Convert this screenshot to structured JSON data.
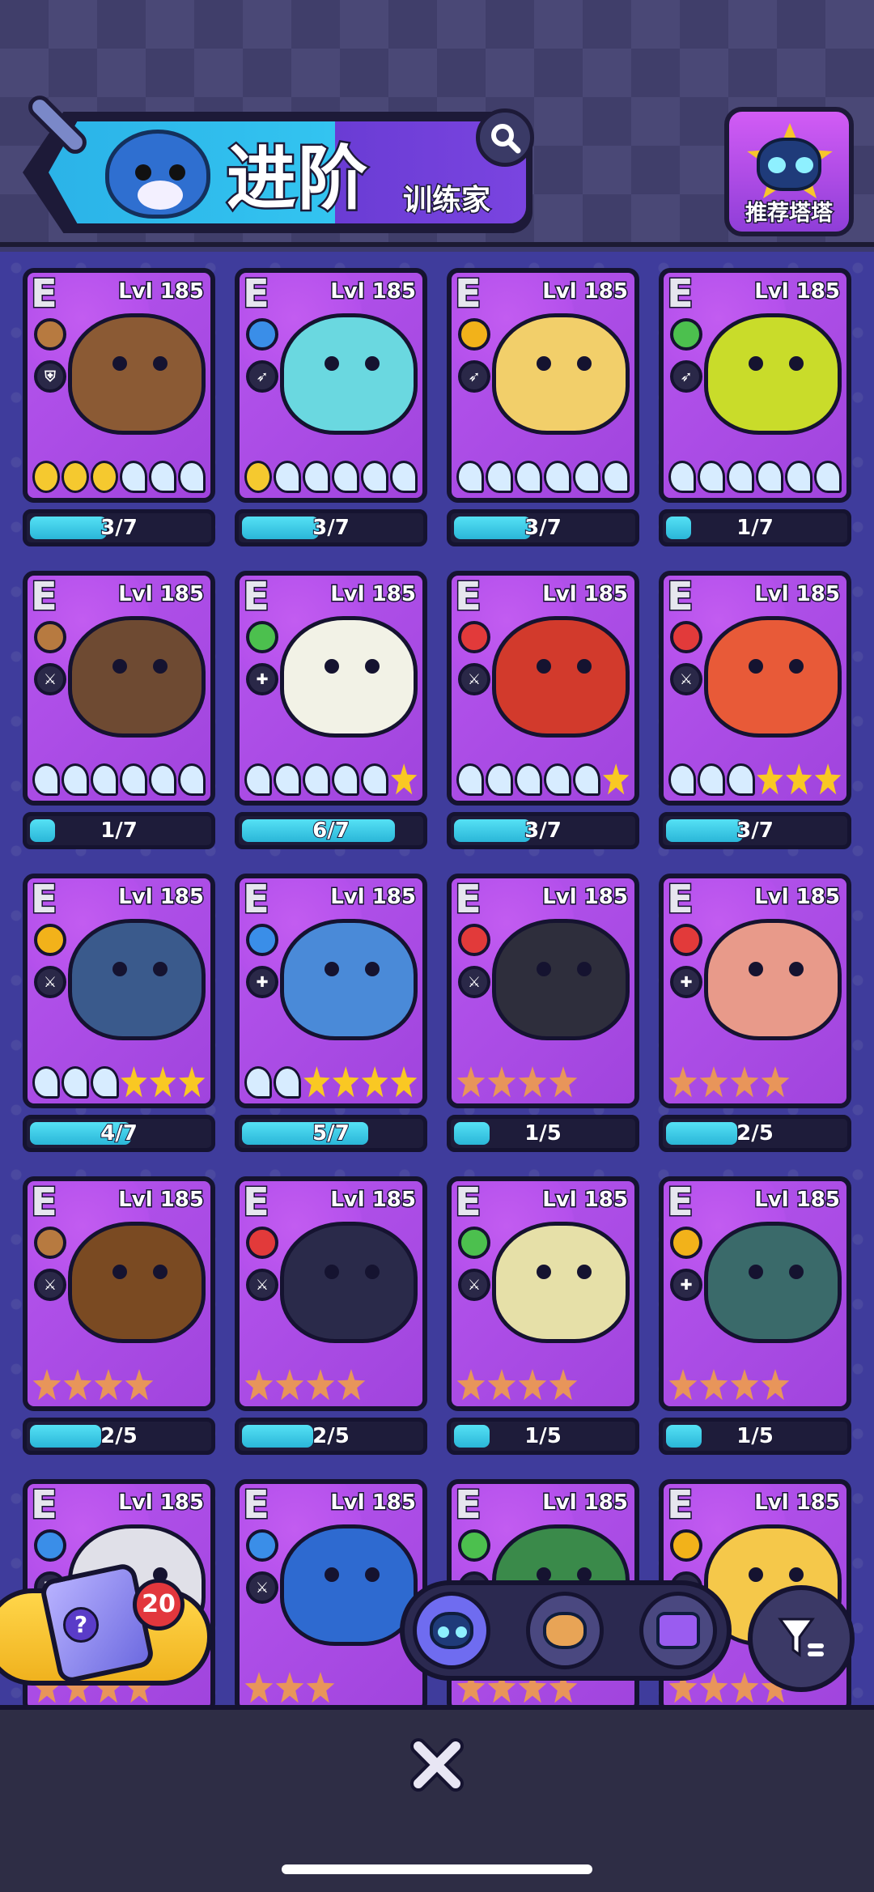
{
  "header": {
    "title": "进阶",
    "subtitle": "训练家",
    "recommend_label": "推荐塔塔"
  },
  "icons": {
    "search": "search-icon",
    "close": "close-icon",
    "sort": "filter-sort-icon",
    "chest": "mystery-box-icon"
  },
  "colors": {
    "card_bg": "#a346e0",
    "progress_fill": "#2ab6d8",
    "star_gold": "#f9c823",
    "star_bronze": "#e8955a",
    "accent_yellow": "#f0b21e",
    "badge_red": "#e2373d"
  },
  "cards": [
    {
      "grade": "E",
      "level": "Lvl 185",
      "type": "earth",
      "role": "shield",
      "ranks": [
        "moon",
        "moon",
        "moon",
        "wave",
        "wave",
        "wave"
      ],
      "progress_text": "3/7",
      "progress": 0.43,
      "creature_color": "#8b5a34"
    },
    {
      "grade": "E",
      "level": "Lvl 185",
      "type": "water",
      "role": "dash",
      "ranks": [
        "moon",
        "wave",
        "wave",
        "wave",
        "wave",
        "wave"
      ],
      "progress_text": "3/7",
      "progress": 0.43,
      "creature_color": "#6ad8e0"
    },
    {
      "grade": "E",
      "level": "Lvl 185",
      "type": "electric",
      "role": "dash",
      "ranks": [
        "wave",
        "wave",
        "wave",
        "wave",
        "wave",
        "wave"
      ],
      "progress_text": "3/7",
      "progress": 0.43,
      "creature_color": "#f2cf6a"
    },
    {
      "grade": "E",
      "level": "Lvl 185",
      "type": "grass",
      "role": "dash",
      "ranks": [
        "wave",
        "wave",
        "wave",
        "wave",
        "wave",
        "wave"
      ],
      "progress_text": "1/7",
      "progress": 0.14,
      "creature_color": "#c9dc2a"
    },
    {
      "grade": "E",
      "level": "Lvl 185",
      "type": "earth",
      "role": "sword",
      "ranks": [
        "wave",
        "wave",
        "wave",
        "wave",
        "wave",
        "wave"
      ],
      "progress_text": "1/7",
      "progress": 0.14,
      "creature_color": "#6e4a32"
    },
    {
      "grade": "E",
      "level": "Lvl 185",
      "type": "grass",
      "role": "heal",
      "ranks": [
        "wave",
        "wave",
        "wave",
        "wave",
        "wave",
        "star"
      ],
      "progress_text": "6/7",
      "progress": 0.86,
      "creature_color": "#f2f2e6"
    },
    {
      "grade": "E",
      "level": "Lvl 185",
      "type": "fire",
      "role": "sword",
      "ranks": [
        "wave",
        "wave",
        "wave",
        "wave",
        "wave",
        "star"
      ],
      "progress_text": "3/7",
      "progress": 0.43,
      "creature_color": "#d23a2c"
    },
    {
      "grade": "E",
      "level": "Lvl 185",
      "type": "fire",
      "role": "sword",
      "ranks": [
        "wave",
        "wave",
        "wave",
        "star",
        "star",
        "star"
      ],
      "progress_text": "3/7",
      "progress": 0.43,
      "creature_color": "#e85a38"
    },
    {
      "grade": "E",
      "level": "Lvl 185",
      "type": "electric",
      "role": "sword",
      "ranks": [
        "wave",
        "wave",
        "wave",
        "star",
        "star",
        "star"
      ],
      "progress_text": "4/7",
      "progress": 0.57,
      "creature_color": "#3a5a8c"
    },
    {
      "grade": "E",
      "level": "Lvl 185",
      "type": "water",
      "role": "heal",
      "ranks": [
        "wave",
        "wave",
        "star",
        "star",
        "star",
        "star"
      ],
      "progress_text": "5/7",
      "progress": 0.71,
      "creature_color": "#4a8ad8"
    },
    {
      "grade": "E",
      "level": "Lvl 185",
      "type": "fire",
      "role": "sword",
      "ranks": [
        "bstar",
        "bstar",
        "bstar",
        "bstar"
      ],
      "progress_text": "1/5",
      "progress": 0.2,
      "creature_color": "#2e2e3c"
    },
    {
      "grade": "E",
      "level": "Lvl 185",
      "type": "fire",
      "role": "heal",
      "ranks": [
        "bstar",
        "bstar",
        "bstar",
        "bstar"
      ],
      "progress_text": "2/5",
      "progress": 0.4,
      "creature_color": "#e89a8a"
    },
    {
      "grade": "E",
      "level": "Lvl 185",
      "type": "earth",
      "role": "sword",
      "ranks": [
        "bstar",
        "bstar",
        "bstar",
        "bstar"
      ],
      "progress_text": "2/5",
      "progress": 0.4,
      "creature_color": "#7a4a22"
    },
    {
      "grade": "E",
      "level": "Lvl 185",
      "type": "fire",
      "role": "sword",
      "ranks": [
        "bstar",
        "bstar",
        "bstar",
        "bstar"
      ],
      "progress_text": "2/5",
      "progress": 0.4,
      "creature_color": "#2a2a4a"
    },
    {
      "grade": "E",
      "level": "Lvl 185",
      "type": "grass",
      "role": "sword",
      "ranks": [
        "bstar",
        "bstar",
        "bstar",
        "bstar"
      ],
      "progress_text": "1/5",
      "progress": 0.2,
      "creature_color": "#e6e0a8"
    },
    {
      "grade": "E",
      "level": "Lvl 185",
      "type": "electric",
      "role": "heal",
      "ranks": [
        "bstar",
        "bstar",
        "bstar",
        "bstar"
      ],
      "progress_text": "1/5",
      "progress": 0.2,
      "creature_color": "#3a6a6a"
    },
    {
      "grade": "E",
      "level": "Lvl 185",
      "type": "water",
      "role": "shield",
      "ranks": [
        "bstar",
        "bstar",
        "bstar",
        "bstar"
      ],
      "progress_text": "",
      "progress": 0,
      "creature_color": "#e0e0e8"
    },
    {
      "grade": "E",
      "level": "Lvl 185",
      "type": "water",
      "role": "sword",
      "ranks": [
        "bstar",
        "bstar",
        "bstar"
      ],
      "progress_text": "",
      "progress": 0,
      "creature_color": "#2e6ad0"
    },
    {
      "grade": "E",
      "level": "Lvl 185",
      "type": "grass",
      "role": "sword",
      "ranks": [
        "bstar",
        "bstar",
        "bstar",
        "bstar"
      ],
      "progress_text": "",
      "progress": 0,
      "creature_color": "#3a8a4a"
    },
    {
      "grade": "E",
      "level": "Lvl 185",
      "type": "electric",
      "role": "sword",
      "ranks": [
        "bstar",
        "bstar",
        "bstar",
        "bstar"
      ],
      "progress_text": "",
      "progress": 0,
      "creature_color": "#f5c84a"
    }
  ],
  "chest": {
    "count": "20",
    "glyph": "?"
  },
  "filters": [
    {
      "name": "filter-tata",
      "active": true
    },
    {
      "name": "filter-pet",
      "active": false
    },
    {
      "name": "filter-badge",
      "active": false
    }
  ]
}
